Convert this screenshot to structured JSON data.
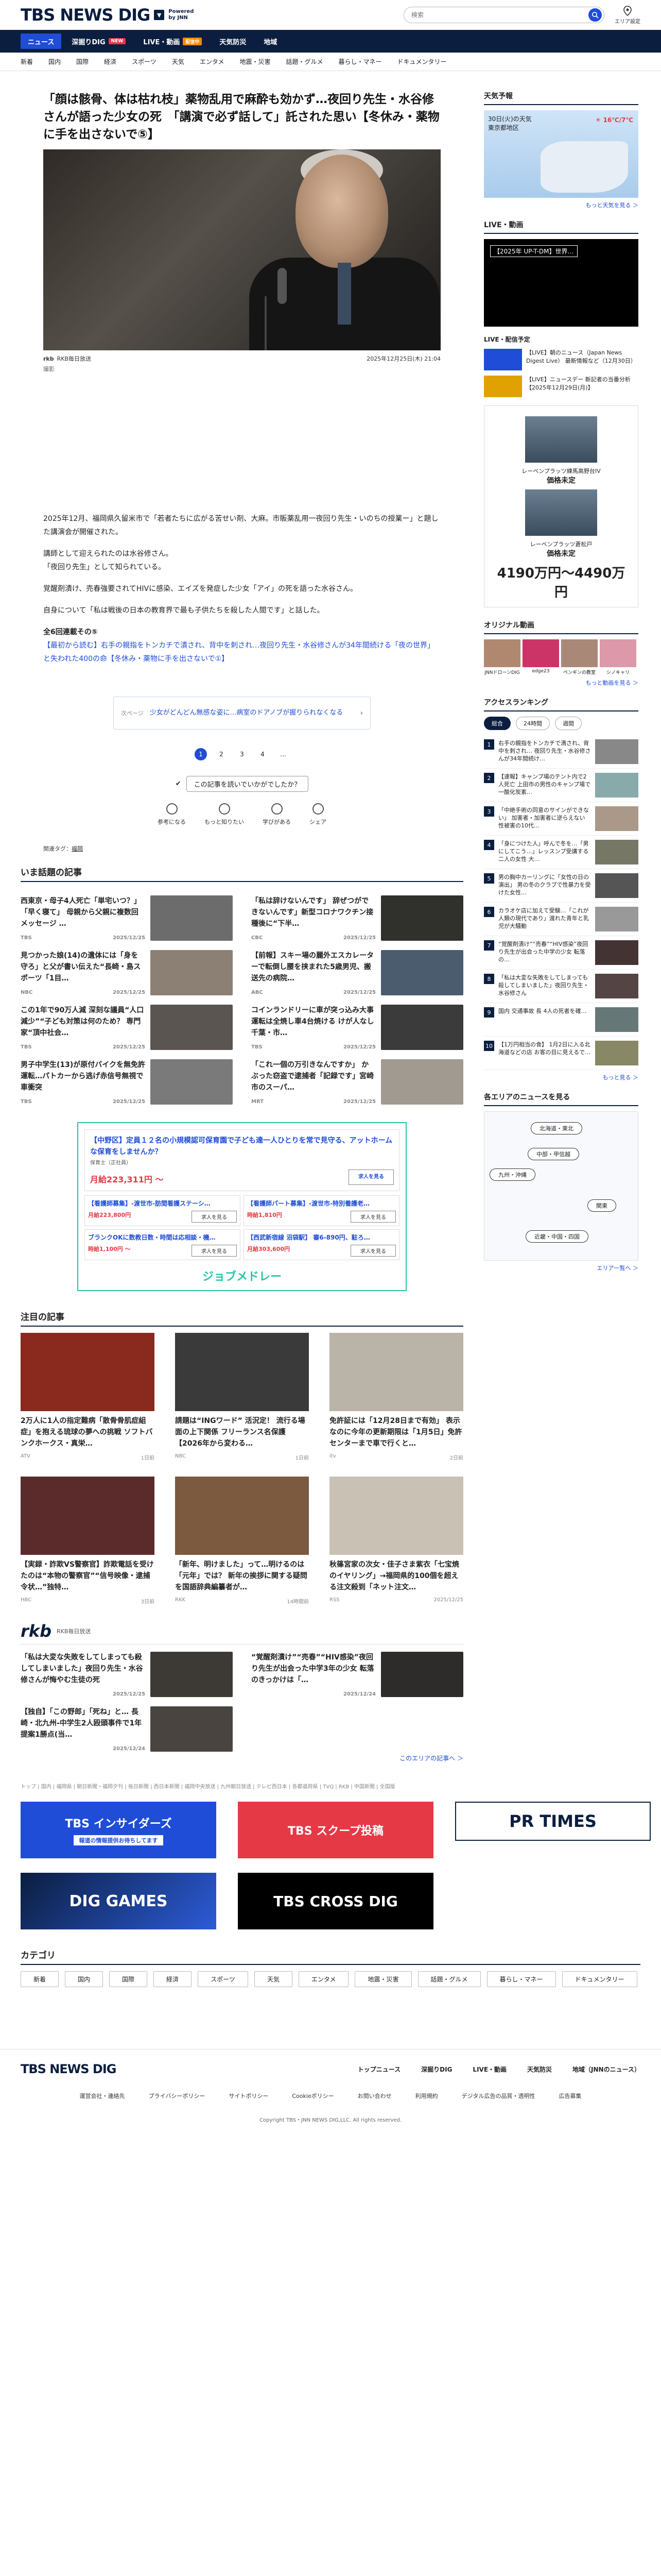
{
  "header": {
    "logo_text": "TBS NEWS DIG",
    "logo_sub1": "Powered",
    "logo_sub2": "by JNN",
    "search_placeholder": "検索",
    "area_label": "エリア設定"
  },
  "nav": [
    {
      "label": "ニュース",
      "badge": ""
    },
    {
      "label": "深掘りDIG",
      "badge": "NEW"
    },
    {
      "label": "LIVE・動画",
      "badge": "配信中"
    },
    {
      "label": "天気防災",
      "badge": ""
    },
    {
      "label": "地域",
      "badge": ""
    }
  ],
  "subnav": [
    "新着",
    "国内",
    "国際",
    "経済",
    "スポーツ",
    "天気",
    "エンタメ",
    "地震・災害",
    "話題・グルメ",
    "暮らし・マネー",
    "ドキュメンタリー"
  ],
  "article": {
    "title": "「顔は骸骨、体は枯れ枝」薬物乱用で麻酔も効かず…夜回り先生・水谷修さんが語った少女の死　「講演で必ず話して」託された思い【冬休み・薬物に手を出さないで⑤】",
    "source": "RKB毎日放送",
    "date": "2025年12月25日(木) 21:04",
    "caption": "撮影",
    "paragraphs": [
      "2025年12月、福岡県久留米市で「若者たちに広がる苦せい剤、大麻。市販薬乱用一夜回り先生・いのちの授業ー」と題した講演会が開催された。",
      "講師として迎えられたのは水谷修さん。",
      "「夜回り先生」として知られている。",
      "覚醒剤漬け、売春強要されてHIVに感染、エイズを発症した少女「アイ」の死を語った水谷さん。",
      "自身について「私は戦後の日本の教育界で最も子供たちを殺した人間です」と話した。"
    ],
    "related_heading": "全6回連載その⑤",
    "related_link": "【最初から読む】右手の親指をトンカチで潰され、背中を刺され…夜回り先生・水谷修さんが34年間続ける「夜の世界」と失われた400の命【冬休み・薬物に手を出さないで①】",
    "next_label": "次ページ",
    "next_text": "少女がどんどん無感な姿に…病室のドアノブが握りられなくなる",
    "pages": [
      "1",
      "2",
      "3",
      "4",
      "…"
    ],
    "reaction_question": "この記事を読いでいかがでしたか？",
    "reactions": [
      "参考になる",
      "もっと知りたい",
      "学びがある",
      "シェア"
    ],
    "tags_label": "関連タグ：",
    "tag": "福岡"
  },
  "hot": {
    "title": "いま話題の記事",
    "items": [
      {
        "text": "西東京・母子4人死亡「単宅いつ？」「早く寝て」 母親から父親に複数回メッセージ …",
        "src": "TBS",
        "time": "2025/12/25"
      },
      {
        "text": "「私は辞けないんです」 辞ぜつができないんです」新型コロナワクチン接種後に“下半…",
        "src": "CBC",
        "time": "2025/12/25"
      },
      {
        "text": "見つかった娘(14)の遺体には「身を守ろ」と父が書い伝えた“長崎・島スポーツ「1目…",
        "src": "NBC",
        "time": "2025/12/25"
      },
      {
        "text": "【前報】スキー場の麗外エスカレーターで転倒し腰を挟まれた5歳男児、搬送先の病院…",
        "src": "ABC",
        "time": "2025/12/25"
      },
      {
        "text": "この1年で90万人減 深刻な議員“人口減少”“子ども対策は何のため？ 専門家“頂中社会…",
        "src": "TBS",
        "time": "2025/12/25"
      },
      {
        "text": "コインランドリーに車が突っ込み大事 運転は全焼し車4台焼ける けが人なし 千葉・市…",
        "src": "TBS",
        "time": "2025/12/25"
      },
      {
        "text": "男子中学生(13)が原付バイクを無免許運転…パトカーから逃げ赤信号無視で車衝突",
        "src": "TBS",
        "time": "2025/12/25"
      },
      {
        "text": "「これ一個の万引きなんですか」 かぶった窃盗で逮捕者「記録です」宮崎市のスーパ…",
        "src": "MRT",
        "time": "2025/12/25"
      }
    ]
  },
  "ad": {
    "top_text": "【中野区】定員１２名の小規模認可保育園で子ども達一人ひとりを常で見守る、アットホームな保育をしませんか？",
    "top_sub": "保育士（正社員）",
    "salary": "月給223,311円 ～",
    "btn": "求人を見る",
    "cells": [
      {
        "title": "【看護師募集】-渡世市-肪間看護ステーシ…",
        "pay": "月給223,800円"
      },
      {
        "title": "【看護師パート募集】-渡世市-特別養護老…",
        "pay": "時給1,810円"
      },
      {
        "title": "ブランクOKに数教日数・時間は応相談・機…",
        "pay": "時給1,100円 ～"
      },
      {
        "title": "【西武新宿線 沼袋駅】 審6-890円、駐ろ…",
        "pay": "月給303,600円"
      }
    ],
    "logo": "ジョブメドレー"
  },
  "featured": {
    "title": "注目の記事",
    "items": [
      {
        "text": "2万人に1人の指定難病「散骨骨肌症組症」を抱える琉球の夢への挑戦 ソフトバンクホークス・真栄…",
        "src": "ATV",
        "time": "1日前"
      },
      {
        "text": "請題は“INGワード” 活況定！ 流行る場面の上下関係 フリーランス名保護【2026年から変わる…",
        "src": "NBC",
        "time": "1日前"
      },
      {
        "text": "免許証には「12月28日まで有効」 表示なのに今年の更新期限は「1月5日」免許センターまで車で行くと…",
        "src": "itv",
        "time": "2日前"
      },
      {
        "text": "【実録・詐欺VS警察官】詐欺電話を受けたのは“本物の警察官”“信号映像・逮捕令状…”独特…",
        "src": "HBC",
        "time": "3日前"
      },
      {
        "text": "「新年、明けました」って…明けるのは「元年」では？ 新年の挨拶に関する疑問を国語辞典編纂者が…",
        "src": "RKK",
        "time": "14時間前"
      },
      {
        "text": "秋篠宮家の次女・佳子さま紫衣「七宝焼のイヤリング」→福岡県的100個を超える注文殺到「ネット注文…",
        "src": "RSS",
        "time": "2025/12/25"
      }
    ]
  },
  "rkb": {
    "logo": "rkb",
    "sub": "RKB毎日放送",
    "items": [
      {
        "text": "「私は大変な失敗をしてしまっても殺してしまいました」夜回り先生・水谷修さんが悔やむ生徒の死",
        "time": "2025/12/25"
      },
      {
        "text": "“覚醒剤漬け”“売春”“HIV感染”夜回り先生が出会った中学3年の少女 転落のきっかけは「…",
        "time": "2025/12/24"
      },
      {
        "text": "【独自】「この野郎」「死ね」と… 長崎・北九州-中学生2人殴頭事件で1年 提案1勝点(当…",
        "time": "2025/12/24"
      }
    ],
    "more": "このエリアの記事へ ＞"
  },
  "sidebar": {
    "weather_title": "天気予報",
    "weather_date": "30日(火)の天気",
    "weather_area": "東京都地区",
    "weather_temp": "16℃/7℃",
    "weather_more": "もっと天気を見る ＞",
    "live_title": "LIVE・動画",
    "live_tag": "【2025年 UP-T-DM】世界…",
    "live_list_title": "LIVE・配信予定",
    "live_items": [
      {
        "text": "【LIVE】朝のニュース（Japan News Digest Live） 最新情報など（12月30日）"
      },
      {
        "text": "【LIVE】ニュースデー 新記者の当番分析 【2025年12月29日(月)】"
      }
    ],
    "ad_name1": "レーベンプラッツ練馬高野台IV",
    "ad_price_label": "価格未定",
    "ad_name2": "レーベンプラッツ蒼松戸",
    "ad_price": "4190万円～4490万円",
    "video_title": "オリジナル動画",
    "videos": [
      "JNNドローンDIG",
      "edge23",
      "ペンギンの教室",
      "シノキャリ"
    ],
    "video_more": "もっと動画を見る ＞",
    "rank_title": "アクセスランキング",
    "rank_tabs": [
      "総合",
      "24時間",
      "週間"
    ],
    "rank_items": [
      "右手の親指をトンカチで潰され、背中を刺され… 夜回り先生・水谷修さんが34年間続け…",
      "【速報】キャンプ場のテント内で2人死亡 上田市の男性のキャンプ場で一酸化炭素…",
      "「中絶手術の同意のサインができない」 加害者・加害者に逆らえない 性被害の10代…",
      "「身につけた人」呼んで冬を…「男にしてこう…」レッスンプ受講する二人の女性 大…",
      "男の胸中カーリングに「女性の日の演出」 男の冬のクラブで性暴力を受けた女性…",
      "カラオケ店に加えて受験…「これが人類の現代であり」渡れた青年と乳児が大騒動",
      "“覚醒剤漬け”“売春”“HIV感染”夜回り先生が出会った中学の少女 転落の…",
      "「私は大変な失敗をしてしまっても殺してしまいました」夜回り先生・水谷修さん",
      "国内 交通事故 長 4人の死者を確…",
      "【1万円相当の食】 1月2日に入る北海道などの店 お客の目に見えるで…"
    ],
    "rank_more": "もっと見る ＞",
    "area_title": "各エリアのニュースを見る",
    "area_buttons": [
      "北海道・東北",
      "中部・甲信越",
      "九州・沖縄",
      "関東",
      "近畿・中国・四国"
    ],
    "area_more": "エリア一覧へ ＞"
  },
  "sources_line": "トップ | 国内 | 福岡県 | 朝日新聞・福岡夕刊 | 毎日新聞 | 西日本新聞 | 福岡中央放送 | 九州朝日放送 | テレビ西日本 | 各都道府県 | TVQ | RKB | 中国新聞 | 全国版",
  "banners": {
    "b1": "TBS インサイダーズ",
    "b1_sub": "報道の情報提供お待ちしてます",
    "b2": "TBS スクープ投稿",
    "b3": "PR TIMES",
    "b4": "DIG GAMES",
    "b5": "TBS CROSS DIG"
  },
  "category": {
    "title": "カテゴリ",
    "items": [
      "新着",
      "国内",
      "国際",
      "経済",
      "スポーツ",
      "天気",
      "エンタメ",
      "地震・災害",
      "話題・グルメ",
      "暮らし・マネー",
      "ドキュメンタリー"
    ]
  },
  "footer": {
    "logo": "TBS NEWS DIG",
    "links": [
      "トップニュース",
      "深掘りDIG",
      "LIVE・動画",
      "天気防災",
      "地域（JNNのニュース）"
    ],
    "sub_links": [
      "運営会社・連絡先",
      "プライバシーポリシー",
      "サイトポリシー",
      "Cookieポリシー",
      "お問い合わせ",
      "利用規約",
      "デジタル広告の品質・透明性",
      "広告募集"
    ],
    "copyright": "Copyright TBS・JNN NEWS DIG,LLC. All rights reserved."
  }
}
